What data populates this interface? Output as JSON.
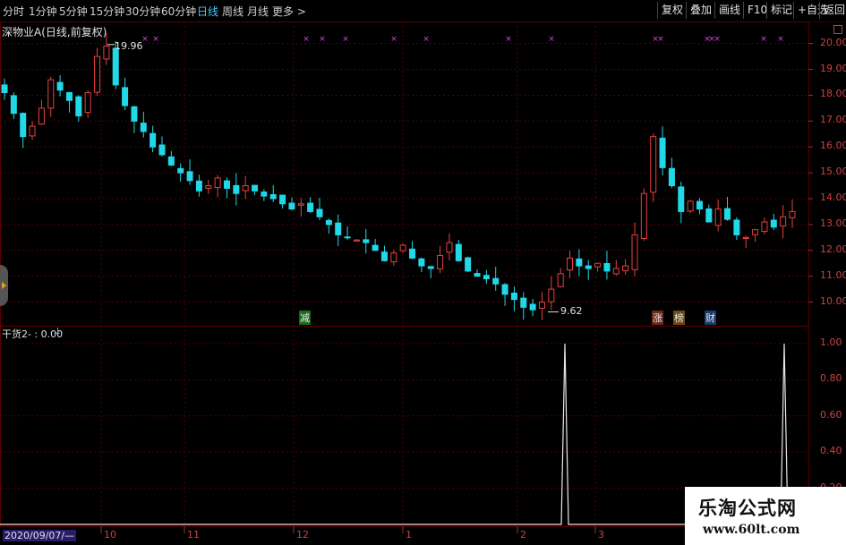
{
  "toolbar": {
    "periods": [
      "分时",
      "1分钟",
      "5分钟",
      "15分钟",
      "30分钟",
      "60分钟",
      "日线",
      "周线",
      "月线",
      "更多 >"
    ],
    "active_period": "日线",
    "buttons": [
      "复权",
      "叠加",
      "画线",
      "F10",
      "标记",
      "+自选",
      "返回"
    ]
  },
  "main_chart": {
    "title": "深物业A(日线,前复权)",
    "price_axis": [
      "20.00",
      "19.00",
      "18.00",
      "17.00",
      "16.00",
      "15.00",
      "14.00",
      "13.00",
      "12.00",
      "11.00",
      "10.00"
    ],
    "high_label": "19.96",
    "low_label": "9.62",
    "event_tags": [
      "减",
      "涨",
      "榜",
      "财"
    ]
  },
  "sub_chart": {
    "indicator_label": "干货2- : 0.00",
    "axis": [
      "1.00",
      "0.80",
      "0.60",
      "0.40",
      "0.20"
    ]
  },
  "time_axis": {
    "start_date": "2020/09/07/—",
    "months": [
      "10",
      "11",
      "12",
      "1",
      "2",
      "3"
    ]
  },
  "watermark": {
    "title": "乐淘公式网",
    "url": "www.60lt.com"
  },
  "colors": {
    "up": "#e84040",
    "down": "#20d8e8",
    "marker": "#e040e0",
    "grid": "#5a0000"
  },
  "chart_data": {
    "type": "candlestick",
    "title": "深物业A(日线,前复权)",
    "ylim": [
      9.5,
      20.3
    ],
    "high": 19.96,
    "low": 9.62,
    "closes": [
      18.1,
      17.3,
      16.4,
      16.8,
      17.5,
      18.6,
      18.2,
      17.8,
      17.2,
      18.1,
      19.5,
      19.9,
      18.4,
      17.6,
      17.0,
      16.6,
      16.0,
      15.7,
      15.3,
      15.0,
      14.7,
      14.3,
      14.5,
      14.8,
      14.4,
      14.2,
      14.5,
      14.3,
      14.1,
      14.0,
      13.8,
      13.6,
      13.8,
      13.5,
      13.3,
      13.0,
      12.6,
      12.5,
      12.4,
      12.3,
      12.0,
      11.6,
      11.9,
      12.2,
      11.7,
      11.4,
      11.3,
      11.8,
      12.3,
      11.6,
      11.2,
      11.0,
      10.9,
      10.7,
      10.3,
      10.1,
      9.8,
      9.7,
      10.0,
      10.5,
      11.1,
      11.7,
      11.4,
      11.3,
      11.5,
      11.2,
      11.3,
      11.4,
      12.6,
      14.2,
      16.4,
      15.2,
      14.5,
      13.5,
      13.9,
      13.6,
      13.1,
      13.6,
      13.2,
      12.6,
      12.5,
      12.8,
      13.1,
      12.9,
      13.3,
      13.5
    ],
    "indicator": {
      "name": "干货2",
      "spike_positions_month": [
        "2",
        "3"
      ],
      "values_range": [
        0,
        1
      ]
    }
  }
}
